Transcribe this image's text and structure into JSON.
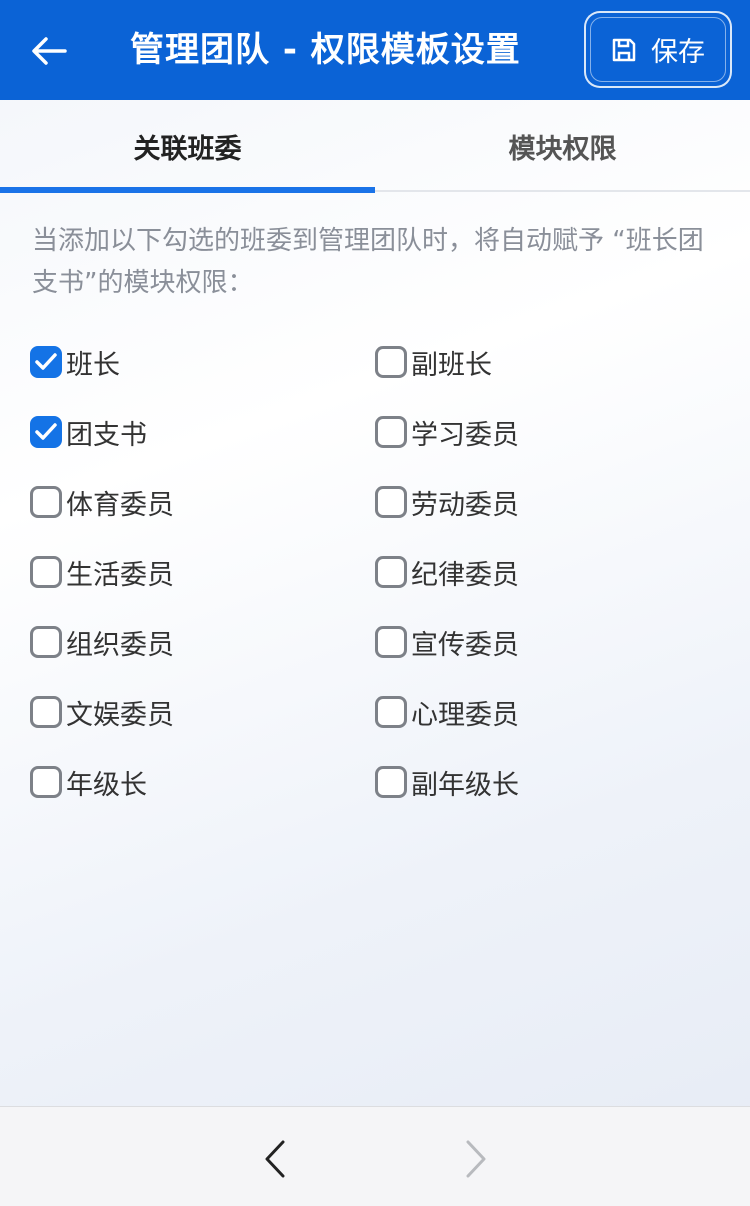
{
  "header": {
    "title": "管理团队 - 权限模板设置",
    "save_label": "保存",
    "color": "#0b63d6"
  },
  "tabs": [
    {
      "label": "关联班委",
      "active": true
    },
    {
      "label": "模块权限",
      "active": false
    }
  ],
  "description": "当添加以下勾选的班委到管理团队时，将自动赋予 “班长团支书”的模块权限：",
  "roles": [
    {
      "label": "班长",
      "checked": true
    },
    {
      "label": "副班长",
      "checked": false
    },
    {
      "label": "团支书",
      "checked": true
    },
    {
      "label": "学习委员",
      "checked": false
    },
    {
      "label": "体育委员",
      "checked": false
    },
    {
      "label": "劳动委员",
      "checked": false
    },
    {
      "label": "生活委员",
      "checked": false
    },
    {
      "label": "纪律委员",
      "checked": false
    },
    {
      "label": "组织委员",
      "checked": false
    },
    {
      "label": "宣传委员",
      "checked": false
    },
    {
      "label": "文娱委员",
      "checked": false
    },
    {
      "label": "心理委员",
      "checked": false
    },
    {
      "label": "年级长",
      "checked": false
    },
    {
      "label": "副年级长",
      "checked": false
    }
  ],
  "accent_color": "#1473e6"
}
